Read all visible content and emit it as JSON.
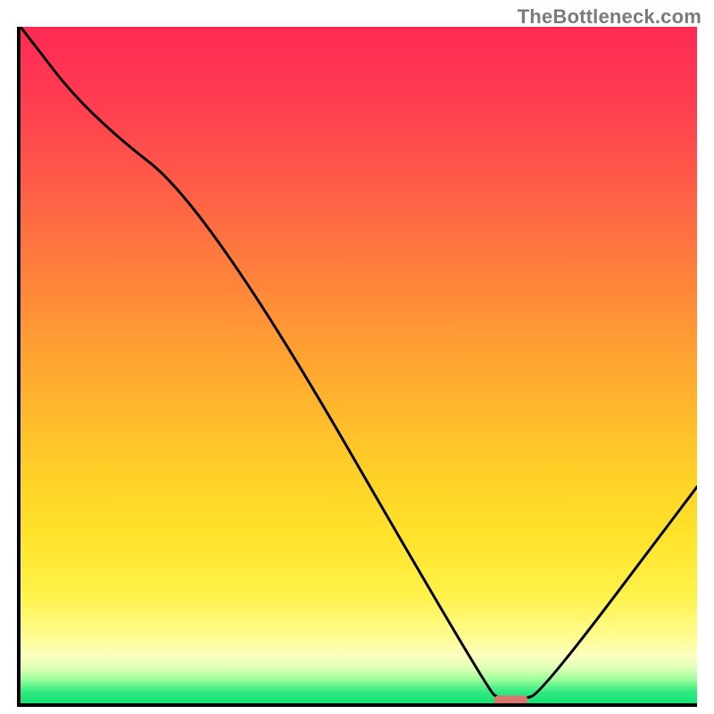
{
  "watermark": "TheBottleneck.com",
  "chart_data": {
    "type": "line",
    "title": "",
    "xlabel": "",
    "ylabel": "",
    "xlim": [
      0,
      100
    ],
    "ylim": [
      0,
      100
    ],
    "series": [
      {
        "name": "bottleneck-curve",
        "x": [
          0,
          10,
          28,
          69,
          71,
          74,
          77,
          100
        ],
        "y": [
          100,
          87,
          73,
          2,
          0.5,
          0.5,
          1.5,
          32
        ]
      }
    ],
    "marker": {
      "name": "optimal-point",
      "x_center": 72.5,
      "y": 0.5,
      "width": 5,
      "color": "#d7766f"
    },
    "gradient_stops": [
      {
        "pct": 0,
        "color": "#ff2a55"
      },
      {
        "pct": 34,
        "color": "#ff7a3e"
      },
      {
        "pct": 66,
        "color": "#ffd028"
      },
      {
        "pct": 90,
        "color": "#fffb8e"
      },
      {
        "pct": 100,
        "color": "#17e277"
      }
    ],
    "notes": "y appears to represent bottleneck percentage (high=red top, low=green bottom); valley near x≈72 marks the balanced point. Values are visual estimates — axes have no labels or ticks."
  }
}
